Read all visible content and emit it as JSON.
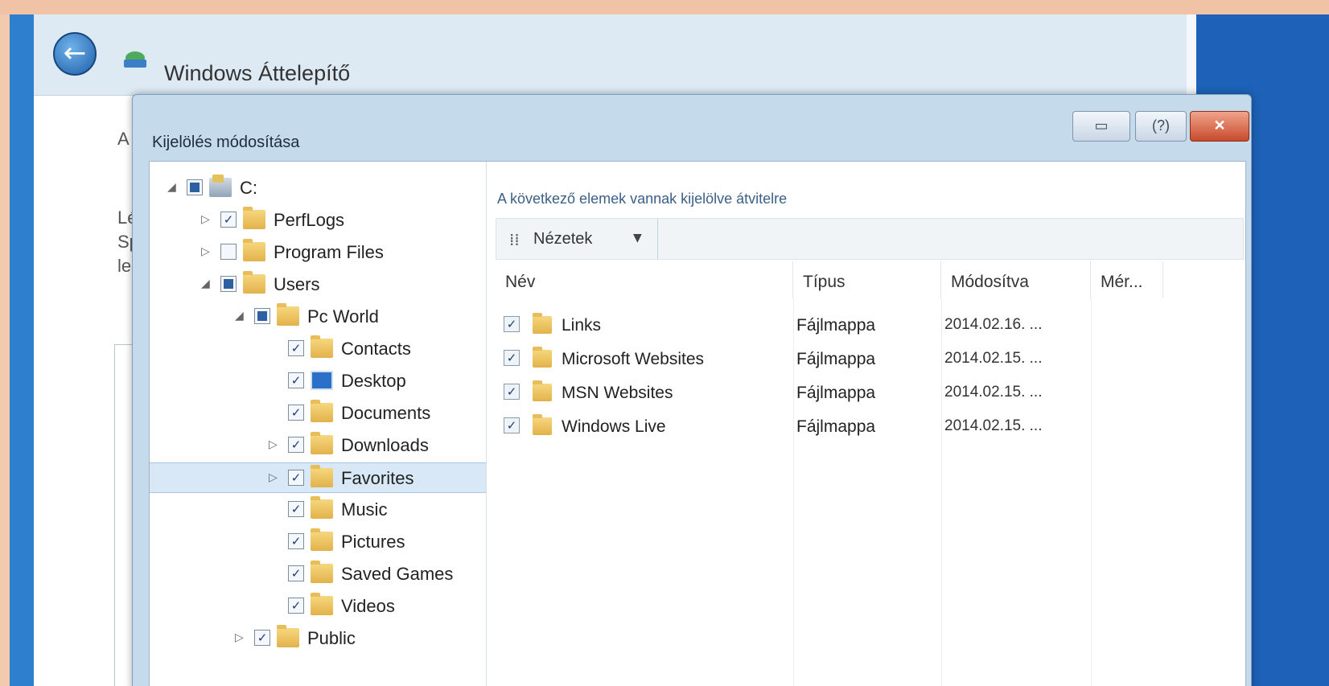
{
  "app": {
    "title": "Windows Áttelepítő",
    "back_glyph": "←"
  },
  "background_text": {
    "line_a": "A",
    "line_b": "Lé",
    "line_c": "Sp",
    "line_d": "le"
  },
  "dialog": {
    "title": "Kijelölés módosítása",
    "buttons": {
      "minimize": "▭",
      "help": "(?)",
      "close": "✕"
    }
  },
  "tree": {
    "items": [
      {
        "label": "C:",
        "expander": "◢",
        "check": "partial",
        "icon": "drive-icon"
      },
      {
        "label": "PerfLogs",
        "expander": "▷",
        "check": "checked",
        "icon": "folder-icon"
      },
      {
        "label": "Program Files",
        "expander": "▷",
        "check": "unchecked",
        "icon": "folder-icon"
      },
      {
        "label": "Users",
        "expander": "◢",
        "check": "partial",
        "icon": "folder-icon"
      },
      {
        "label": "Pc World",
        "expander": "◢",
        "check": "partial",
        "icon": "user-folder-icon"
      },
      {
        "label": "Contacts",
        "expander": "",
        "check": "checked",
        "icon": "contacts-folder-icon"
      },
      {
        "label": "Desktop",
        "expander": "",
        "check": "checked",
        "icon": "desktop-icon"
      },
      {
        "label": "Documents",
        "expander": "",
        "check": "checked",
        "icon": "documents-folder-icon"
      },
      {
        "label": "Downloads",
        "expander": "▷",
        "check": "checked",
        "icon": "downloads-folder-icon"
      },
      {
        "label": "Favorites",
        "expander": "▷",
        "check": "checked",
        "icon": "favorites-folder-icon",
        "selected": true
      },
      {
        "label": "Music",
        "expander": "",
        "check": "checked",
        "icon": "music-folder-icon"
      },
      {
        "label": "Pictures",
        "expander": "",
        "check": "checked",
        "icon": "pictures-folder-icon"
      },
      {
        "label": "Saved Games",
        "expander": "",
        "check": "checked",
        "icon": "saved-games-folder-icon"
      },
      {
        "label": "Videos",
        "expander": "",
        "check": "checked",
        "icon": "videos-folder-icon"
      },
      {
        "label": "Public",
        "expander": "▷",
        "check": "checked",
        "icon": "folder-icon"
      }
    ]
  },
  "details": {
    "caption": "A következő elemek vannak kijelölve átvitelre",
    "views_button": {
      "label": "Nézetek",
      "icon": "views-icon",
      "caret": "▼"
    },
    "columns": [
      "Név",
      "Típus",
      "Módosítva",
      "Mér..."
    ],
    "rows": [
      {
        "name": "Links",
        "type": "Fájlmappa",
        "modified": "2014.02.16. ..."
      },
      {
        "name": "Microsoft Websites",
        "type": "Fájlmappa",
        "modified": "2014.02.15. ..."
      },
      {
        "name": "MSN Websites",
        "type": "Fájlmappa",
        "modified": "2014.02.15. ..."
      },
      {
        "name": "Windows Live",
        "type": "Fájlmappa",
        "modified": "2014.02.15. ..."
      }
    ]
  },
  "check_glyph": "✓",
  "colors": {
    "accent_blue": "#1d62b8",
    "close_red": "#c84a2d",
    "selection": "#d8e8f7"
  }
}
